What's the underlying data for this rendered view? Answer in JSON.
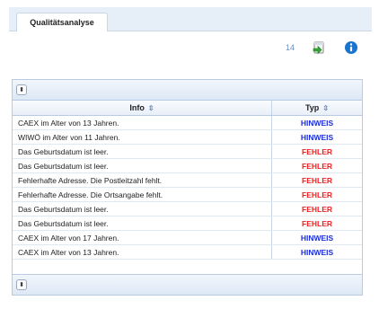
{
  "tabs": [
    {
      "label": "Qualitätsanalyse",
      "active": true
    }
  ],
  "toolbar": {
    "count": "14",
    "export_icon": "export-icon",
    "info_icon": "info-icon"
  },
  "table": {
    "selector_symbol": "⬍",
    "columns": [
      {
        "label": "Info",
        "sort_icon": "sort-icon"
      },
      {
        "label": "Typ",
        "sort_icon": "sort-icon"
      }
    ],
    "rows": [
      {
        "info": "CAEX im Alter von 13 Jahren.",
        "typ": "HINWEIS"
      },
      {
        "info": "WIWÖ im Alter von 11 Jahren.",
        "typ": "HINWEIS"
      },
      {
        "info": "Das Geburtsdatum ist leer.",
        "typ": "FEHLER"
      },
      {
        "info": "Das Geburtsdatum ist leer.",
        "typ": "FEHLER"
      },
      {
        "info": "Fehlerhafte Adresse. Die Postleitzahl fehlt.",
        "typ": "FEHLER"
      },
      {
        "info": "Fehlerhafte Adresse. Die Ortsangabe fehlt.",
        "typ": "FEHLER"
      },
      {
        "info": "Das Geburtsdatum ist leer.",
        "typ": "FEHLER"
      },
      {
        "info": "Das Geburtsdatum ist leer.",
        "typ": "FEHLER"
      },
      {
        "info": "CAEX im Alter von 17 Jahren.",
        "typ": "HINWEIS"
      },
      {
        "info": "CAEX im Alter von 13 Jahren.",
        "typ": "HINWEIS"
      }
    ]
  },
  "colors": {
    "hinweis": "#1f2fd6",
    "fehler": "#ee2222",
    "accent": "#1874cd"
  }
}
